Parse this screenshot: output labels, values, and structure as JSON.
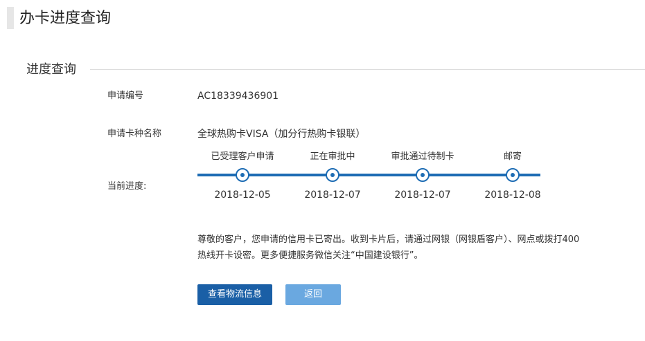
{
  "page": {
    "title": "办卡进度查询"
  },
  "section": {
    "title": "进度查询"
  },
  "fields": {
    "application_no_label": "申请编号",
    "application_no_value": "AC18339436901",
    "card_name_label": "申请卡种名称",
    "card_name_value": "全球热购卡VISA（加分行热购卡银联）",
    "progress_label": "当前进度:"
  },
  "progress": {
    "steps": [
      {
        "label": "已受理客户申请",
        "date": "2018-12-05"
      },
      {
        "label": "正在审批中",
        "date": "2018-12-07"
      },
      {
        "label": "审批通过待制卡",
        "date": "2018-12-07"
      },
      {
        "label": "邮寄",
        "date": "2018-12-08"
      }
    ],
    "track_color": "#1d6cb4"
  },
  "notice": {
    "line1": "尊敬的客户，您申请的信用卡已寄出。收到卡片后，请通过网银（网银盾客户）、网点或拨打400",
    "line2": "热线开卡设密。更多便捷服务微信关注“中国建设银行”。"
  },
  "buttons": {
    "logistics_label": "查看物流信息",
    "back_label": "返回",
    "primary_color": "#1a5fa6",
    "secondary_color": "#6aa8e0"
  }
}
